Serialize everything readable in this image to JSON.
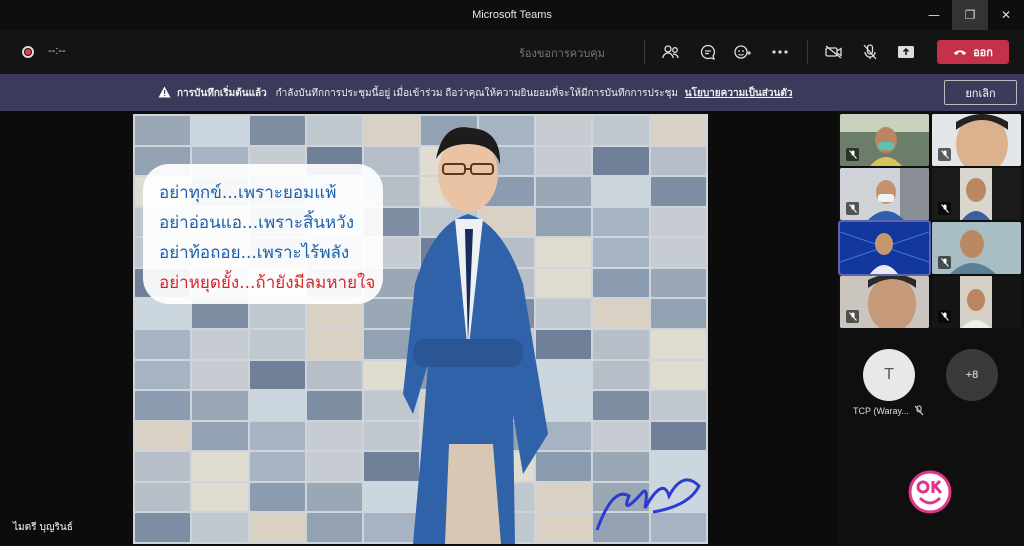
{
  "window": {
    "title": "Microsoft Teams",
    "minimize": "—",
    "restore": "❐",
    "close": "✕"
  },
  "toolbar": {
    "timer": "--:--",
    "request_control": "ร้องขอการควบคุม",
    "leave_label": "ออก"
  },
  "banner": {
    "heading": "การบันทึกเริ่มต้นแล้ว",
    "message": "กำลังบันทึกการประชุมนี้อยู่ เมื่อเข้าร่วม ถือว่าคุณให้ความยินยอมที่จะให้มีการบันทึกการประชุม",
    "policy_link": "นโยบายความเป็นส่วนตัว",
    "cancel_label": "ยกเลิก"
  },
  "presentation": {
    "quote_lines": [
      "อย่าทุกข์...เพราะยอมแพ้",
      "อย่าอ่อนแอ...เพราะสิ้นหวัง",
      "อย่าท้อถอย...เพราะไร้พลัง",
      "อย่าหยุดยั้ง...ถ้ายังมีลมหายใจ"
    ],
    "presenter_name": "ไมตรี บุญรินธ์"
  },
  "participants": {
    "tcp_name": "TCP (Waray...",
    "avatar_initial": "T",
    "overflow_count": "+8"
  },
  "colors": {
    "accent": "#6264a7",
    "leave": "#c4314b",
    "banner": "#3b3a5b",
    "quote_blue": "#1b5fae",
    "quote_red": "#d8262a"
  }
}
